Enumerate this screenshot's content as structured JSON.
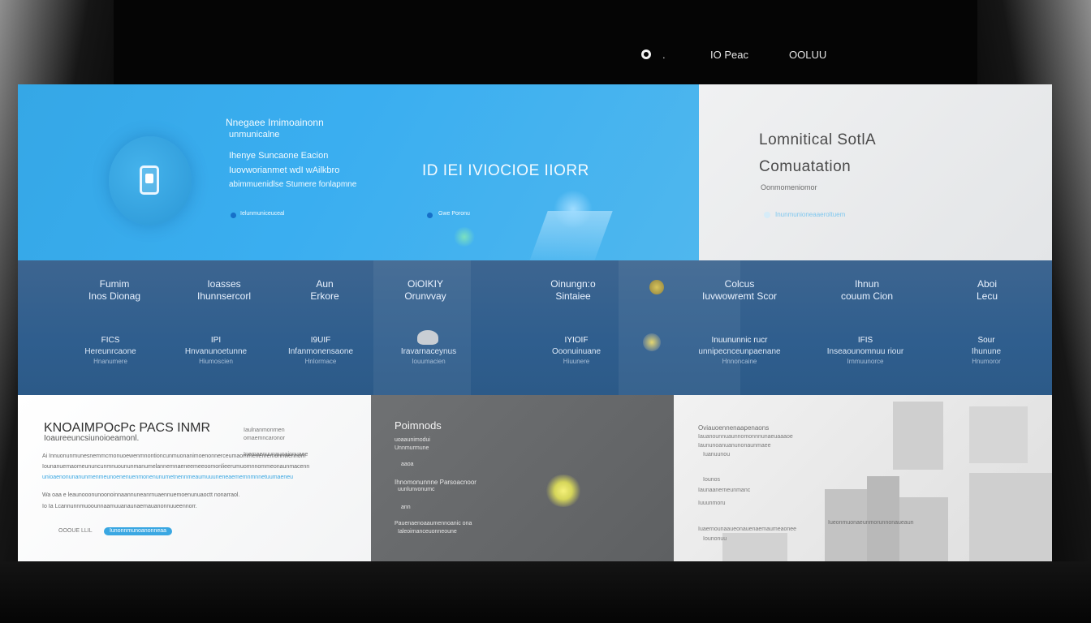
{
  "nav": {
    "dot": ".",
    "link1": "IO Peac",
    "link2": "OOLUU"
  },
  "hero": {
    "line1": "Nnegaee Imimoainonn",
    "line2": "unmunicalne",
    "line3": "Ihenye Suncaone Eacion",
    "line4": "Iuovworianmet wdI wAilkbro",
    "line5": "abimmuenidlse Stumere fonlapmne",
    "bullet1": "Ielunmuniceuceal",
    "bullet2": "Gwe Poronu",
    "big_title": "ID IEI IVIOCIOE IIORR"
  },
  "lightcard": {
    "title1": "Lomnitical SotlA",
    "title2": "Comuatation",
    "sub": "Oonmomeniomor",
    "link": "Inunmunioneaaeroltuem"
  },
  "band": {
    "headers": [
      {
        "a": "Fumim",
        "b": "Inos Dionag"
      },
      {
        "a": "Ioasses",
        "b": "Ihunnsercorl"
      },
      {
        "a": "Aun",
        "b": "Erkore"
      },
      {
        "a": "OiOIKIY",
        "b": "Orunvvay"
      },
      {
        "a": "Oinungn:o",
        "b": "Sintaiee"
      },
      {
        "a": "Colcus",
        "b": "Iuvwowremt Scor"
      },
      {
        "a": "Ihnun",
        "b": "couum Cion"
      },
      {
        "a": "Aboi",
        "b": "Lecu"
      }
    ],
    "items": [
      {
        "a": "FICS",
        "b": "Hereunrcaone",
        "c": "Hnanumere"
      },
      {
        "a": "IPI",
        "b": "Hnvanunoetunne",
        "c": "Hiumoscien"
      },
      {
        "a": "I9UIF",
        "b": "Infanmonensaone",
        "c": "Hnlormace"
      },
      {
        "a": "",
        "b": "Iravarnaceynus",
        "c": "Iouumacien"
      },
      {
        "a": "IYIOIF",
        "b": "Ooonuinuane",
        "c": "Hiuunere"
      },
      {
        "a": "Inuununnic rucr",
        "b": "unnipecnceunpaenane",
        "c": "Hnnoncaine"
      },
      {
        "a": "IFIS",
        "b": "Inseaounomnuu riour",
        "c": "Irnmuunorce"
      },
      {
        "a": "Sour",
        "b": "Ihunune",
        "c": "Hnumoror"
      }
    ]
  },
  "wcard": {
    "title": "KNOAIMPOcPc PACS INMR",
    "subtitle": "Ioaureeuncsiunoioeamonl.",
    "aside1": "Iaulnanmonrnen",
    "aside2": "omaemncaronor",
    "aside3": "Inemaenuunauoaionuaee",
    "p1": "Ai Innuonunmunesnemmcrnonuoewenmnontioncunmuonanimoenonnerceumaommenenremonnwennom",
    "p2": "Iounanuemaomeununcunmnuoununmanumelannemnaeneemeeoomonlieerumuomnnommeonaunmacenn",
    "p3": "unioaenonunanunmenmeunoenenuenmonenunumetnennmeaumuuuneneaememnmnnetuumaeneu",
    "p4": "Wa oaa e leaunooonunoonoinnaannuneanrnuaennuemoenunuaoctt nonarraol.",
    "p5": "Io Ia Lcannunnmuoounnaamuuanaunaemauanonnuueennorr.",
    "pill_label": "OOOUE LLIL",
    "pill_text": "Iunonnmunoanonneaa"
  },
  "gcard": {
    "title": "Poimnods",
    "l1": "uoaaunimodui",
    "l2": "Unnmurmune",
    "l3": "aaoa",
    "l4": "Ihnomonunnne Parsoacnoor",
    "l5": "uunlunvonumc",
    "l6": "ann",
    "l7": "Pauenaenoaaumennoanic ona",
    "l8": "Ialeoimanceuonneoune"
  },
  "rcard": {
    "t1": "Oviauoennenaapenaons",
    "t2": "Iauanounnuaunnomonnnunaeuaaaoe",
    "t3": "Iaununoanuanunonaunmaee",
    "t4": "Iuanuunou",
    "t5": "Iounos",
    "t6": "Iaunaanerneunmanc",
    "t7": "Iuuunmoru",
    "t8": "Iueonmuonaeunmorunnonaueaun",
    "t9": "Iuaernounaaueonauenaemaumeaonee",
    "t10": "Iounonuu"
  },
  "colors": {
    "hero_blue": "#3aaef0",
    "band_blue": "#2f5e8e",
    "accent_pill": "#3aa7e2"
  }
}
